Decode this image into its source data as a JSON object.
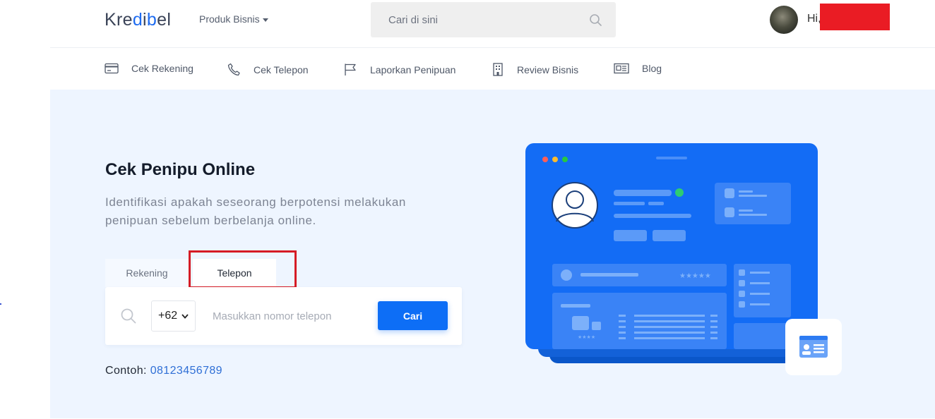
{
  "brand": {
    "logo_text_pre": "Kre",
    "logo_drop": "d",
    "logo_mid": "i",
    "logo_drop2": "b",
    "logo_text_post": "el"
  },
  "header": {
    "produk_label": "Produk Bisnis",
    "search_placeholder": "Cari di sini",
    "greeting": "Hi,"
  },
  "nav": {
    "items": [
      {
        "label": "Cek Rekening",
        "icon": "card-icon"
      },
      {
        "label": "Cek Telepon",
        "icon": "phone-icon"
      },
      {
        "label": "Laporkan Penipuan",
        "icon": "flag-icon"
      },
      {
        "label": "Review Bisnis",
        "icon": "building-icon"
      },
      {
        "label": "Blog",
        "icon": "newspaper-icon"
      }
    ]
  },
  "hero": {
    "title": "Cek Penipu Online",
    "description": "Identifikasi apakah seseorang berpotensi melakukan penipuan sebelum berbelanja online.",
    "tabs": [
      {
        "label": "Rekening",
        "active": false
      },
      {
        "label": "Telepon",
        "active": true
      }
    ],
    "country_code": "+62",
    "phone_placeholder": "Masukkan nomor telepon",
    "search_button": "Cari",
    "example_label": "Contoh:",
    "example_value": "08123456789"
  },
  "colors": {
    "accent": "#0d6ef6",
    "hero_bg": "#eef5ff",
    "highlight": "#d51c26",
    "redaction": "#ea1c24"
  }
}
